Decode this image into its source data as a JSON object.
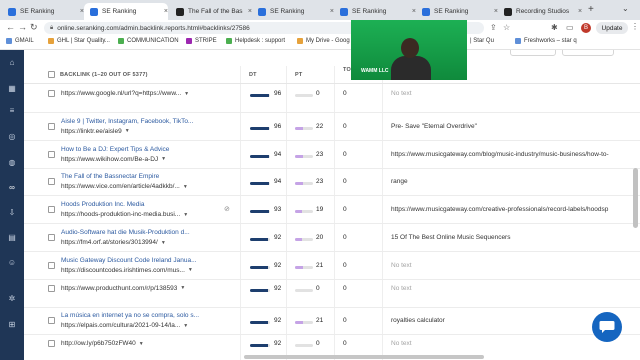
{
  "browser": {
    "tabs": [
      {
        "label": "SE Ranking"
      },
      {
        "label": "SE Ranking"
      },
      {
        "label": "The Fall of the Bas"
      },
      {
        "label": "SE Ranking"
      },
      {
        "label": "SE Ranking"
      },
      {
        "label": "SE Ranking"
      },
      {
        "label": "Recording Studios"
      }
    ],
    "new_tab": "+",
    "url": "online.seranking.com/admin.backlink.reports.html#backlinks/27586",
    "update_label": "Update",
    "profile_initial": "B"
  },
  "bookmarks": [
    {
      "label": "GMAIL"
    },
    {
      "label": "GHL | Star Quality..."
    },
    {
      "label": "COMMUNICATION"
    },
    {
      "label": "STRIPE"
    },
    {
      "label": "Helpdesk : support"
    },
    {
      "label": "My Drive - Goog"
    },
    {
      "label": "| Star Qu"
    },
    {
      "label": "Freshworks – star q"
    }
  ],
  "webcam": {
    "caption": "WAMM LLC"
  },
  "table": {
    "headers": {
      "backlink": "BACKLINK (1–20 OUT OF 5377)",
      "dt": "DT",
      "pt": "PT",
      "tt": "TO TT",
      "anchor": ""
    },
    "rows": [
      {
        "title": "",
        "url": "https://www.google.nl/url?q=https://www...",
        "dt": 96,
        "pt": 0,
        "tt": 0,
        "anchor": "No text",
        "anchor_empty": true
      },
      {
        "title": "Aisle 9 | Twitter, Instagram, Facebook, TikTo...",
        "url": "https://linktr.ee/aisle9",
        "dt": 96,
        "pt": 22,
        "tt": 0,
        "anchor": "Pre- Save \"Eternal Overdrive\"",
        "anchor_empty": false
      },
      {
        "title": "How to Be a DJ: Expert Tips & Advice",
        "url": "https://www.wikihow.com/Be-a-DJ",
        "dt": 94,
        "pt": 23,
        "tt": 0,
        "anchor": "https://www.musicgateway.com/blog/music-industry/music-business/how-to-",
        "anchor_empty": false
      },
      {
        "title": "The Fall of the Bassnectar Empire",
        "url": "https://www.vice.com/en/article/4adkkb/...",
        "dt": 94,
        "pt": 23,
        "tt": 0,
        "anchor": "range",
        "anchor_empty": false
      },
      {
        "title": "Hoods Produktion Inc. Media",
        "url": "https://hoods-produktion-inc-media.busi...",
        "dt": 93,
        "pt": 19,
        "tt": 0,
        "anchor": "https://www.musicgateway.com/creative-professionals/record-labels/hoodsp",
        "anchor_empty": false
      },
      {
        "title": "Audio-Software hat die Musik-Produktion d...",
        "url": "https://fm4.orf.at/stories/3013994/",
        "dt": 92,
        "pt": 20,
        "tt": 0,
        "anchor": "15 Of The Best Online Music Sequencers",
        "anchor_empty": false
      },
      {
        "title": "Music Gateway Discount Code Ireland Janua...",
        "url": "https://discountcodes.irishtimes.com/mus...",
        "dt": 92,
        "pt": 21,
        "tt": 0,
        "anchor": "No text",
        "anchor_empty": true
      },
      {
        "title": "",
        "url": "https://www.producthunt.com/r/p/138593",
        "dt": 92,
        "pt": 0,
        "tt": 0,
        "anchor": "No text",
        "anchor_empty": true
      },
      {
        "title": "La música en internet ya no se compra, solo s...",
        "url": "https://elpais.com/cultura/2021-09-14/la...",
        "dt": 92,
        "pt": 21,
        "tt": 0,
        "anchor": "royalties calculator",
        "anchor_empty": false
      },
      {
        "title": "",
        "url": "http://ow.ly/p6b750zFW40",
        "dt": 92,
        "pt": 0,
        "tt": 0,
        "anchor": "No text",
        "anchor_empty": true
      }
    ]
  },
  "colors": {
    "sidebar": "#1f3656",
    "link": "#2c5aa0",
    "dt_fill": "#1d3e6e",
    "pt_fill": "#c5a3e6",
    "chat": "#1565c0",
    "webcam": "#15a44a"
  },
  "icons": {
    "sidebar": [
      "home-icon",
      "dashboard-icon",
      "list-icon",
      "compass-icon",
      "globe-icon",
      "link-icon",
      "download-icon",
      "document-icon",
      "user-icon",
      "settings-icon",
      "cart-icon"
    ],
    "chat": "chat-bubble-icon"
  }
}
